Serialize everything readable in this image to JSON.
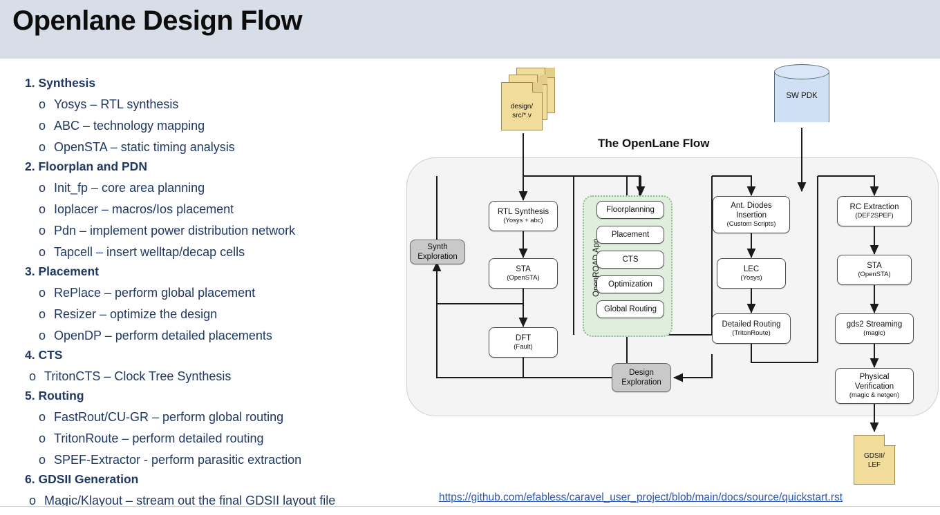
{
  "header": {
    "title": "Openlane Design Flow"
  },
  "steps": [
    {
      "heading": "1. Synthesis",
      "items": [
        "Yosys – RTL synthesis",
        "ABC – technology mapping",
        "OpenSTA – static timing analysis"
      ]
    },
    {
      "heading": "2. Floorplan and PDN",
      "items": [
        "Init_fp – core area planning",
        "Ioplacer – macros/Ios placement",
        "Pdn – implement power distribution network",
        "Tapcell – insert welltap/decap cells"
      ]
    },
    {
      "heading": "3. Placement",
      "items": [
        "RePlace – perform global placement",
        "Resizer – optimize the design",
        "OpenDP – perform detailed placements"
      ]
    },
    {
      "heading": "4. CTS",
      "items": [
        "TritonCTS – Clock Tree Synthesis"
      ]
    },
    {
      "heading": "5. Routing",
      "items": [
        "FastRout/CU-GR – perform global routing",
        "TritonRoute – perform detailed routing",
        "SPEF-Extractor -  perform parasitic extraction"
      ]
    },
    {
      "heading": "6. GDSII Generation",
      "items": [
        "Magic/Klayout – stream out the final GDSII layout file"
      ]
    }
  ],
  "bullet_char": "o",
  "diagram": {
    "title": "The OpenLane Flow",
    "input_file": {
      "line1": "design/",
      "line2": "src/*.v"
    },
    "pdk": {
      "label": "SW PDK"
    },
    "output_file": {
      "line1": "GDSII/",
      "line2": "LEF"
    },
    "openroad_label": "OpenROAD App",
    "nodes": {
      "synth_exploration": {
        "t1": "Synth",
        "t2": "Exploration"
      },
      "rtl_synthesis": {
        "t1": "RTL Synthesis",
        "t2": "(Yosys + abc)"
      },
      "sta_left": {
        "t1": "STA",
        "t2": "(OpenSTA)"
      },
      "dft": {
        "t1": "DFT",
        "t2": "(Fault)"
      },
      "floorplanning": {
        "t1": "Floorplanning"
      },
      "placement": {
        "t1": "Placement"
      },
      "cts": {
        "t1": "CTS"
      },
      "optimization": {
        "t1": "Optimization"
      },
      "global_routing": {
        "t1": "Global Routing"
      },
      "ant_diodes": {
        "t1": "Ant. Diodes",
        "t1b": "Insertion",
        "t2": "(Custom Scripts)"
      },
      "lec": {
        "t1": "LEC",
        "t2": "(Yosys)"
      },
      "detailed_routing": {
        "t1": "Detailed Routing",
        "t2": "(TritonRoute)"
      },
      "rc_extraction": {
        "t1": "RC Extraction",
        "t2": "(DEF2SPEF)"
      },
      "sta_right": {
        "t1": "STA",
        "t2": "(OpenSTA)"
      },
      "gds2_streaming": {
        "t1": "gds2 Streaming",
        "t2": "(magic)"
      },
      "physical_verification": {
        "t1": "Physical",
        "t1b": "Verification",
        "t2": "(magic & netgen)"
      },
      "design_exploration": {
        "t1": "Design",
        "t2b": "Exploration"
      }
    }
  },
  "footer": {
    "link_text": "https://github.com/efabless/caravel_user_project/blob/main/docs/source/quickstart.rst"
  },
  "colors": {
    "header_bg": "#d8dee8",
    "text_blue": "#1f3864",
    "link_blue": "#2b57b5",
    "flow_bg": "#f4f4f4",
    "openroad_green": "#dfeedd",
    "file_yellow": "#f2dc9b",
    "pdk_blue": "#cfe0f4",
    "gray_node": "#c9c9c9"
  }
}
